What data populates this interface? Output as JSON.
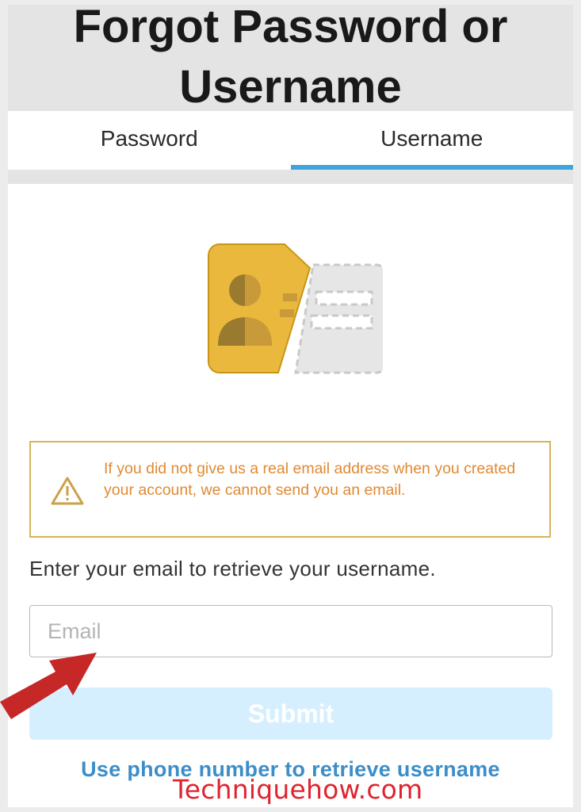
{
  "header": {
    "title_line1": "Forgot Password or",
    "title_line2": "Username"
  },
  "tabs": [
    {
      "label": "Password",
      "active": false
    },
    {
      "label": "Username",
      "active": true
    }
  ],
  "alert": {
    "icon": "warning-icon",
    "text": "If you did not give us a real email address when you created your account, we cannot send you an email."
  },
  "form": {
    "instruction": "Enter your email to retrieve your username.",
    "email_placeholder": "Email",
    "submit_label": "Submit"
  },
  "links": {
    "phone_retrieve": "Use phone number to retrieve username"
  },
  "watermark": "Techniquehow.com",
  "colors": {
    "accent": "#3fa4dc",
    "alert_border": "#d7b45b",
    "alert_text": "#e08a33",
    "submit_bg": "#d6efff",
    "link": "#3b8ec9",
    "illustration_yellow": "#e9b83d",
    "arrow_red": "#c62828"
  }
}
